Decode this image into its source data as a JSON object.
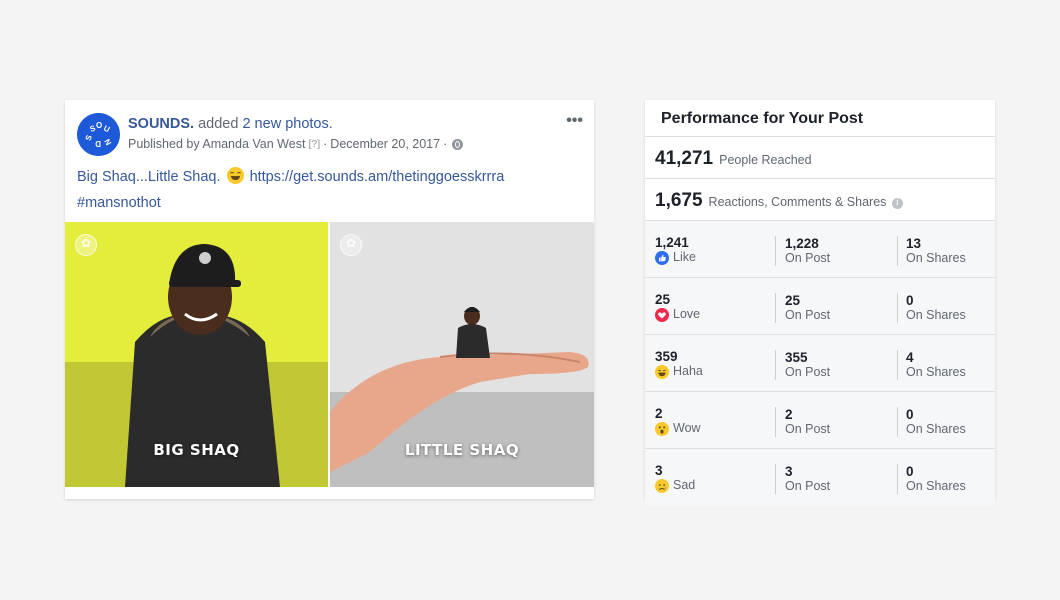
{
  "post": {
    "page_name": "SOUNDS.",
    "action_text": " added ",
    "photos_link": "2 new photos.",
    "published_by": "Published by Amanda Van West",
    "help_marker": "[?]",
    "separator": "·",
    "date": "December 20, 2017",
    "text_prefix": "Big Shaq...Little Shaq.",
    "text_link": "https://get.sounds.am/thetinggoesskrrra",
    "hashtag": "#mansnothot",
    "more_label": "•••",
    "avatar_text": "SOUNDS",
    "photos": [
      {
        "caption": "BIG SHAQ"
      },
      {
        "caption": "LITTLE SHAQ"
      }
    ]
  },
  "performance": {
    "title": "Performance for Your Post",
    "reach": {
      "value": "41,271",
      "label": "People Reached"
    },
    "engagement": {
      "value": "1,675",
      "label": "Reactions, Comments & Shares",
      "info": "i"
    },
    "rows": [
      {
        "total": "1,241",
        "reaction": "Like",
        "icon": "like-icon",
        "on_post": "1,228",
        "on_post_label": "On Post",
        "on_shares": "13",
        "on_shares_label": "On Shares"
      },
      {
        "total": "25",
        "reaction": "Love",
        "icon": "love-icon",
        "on_post": "25",
        "on_post_label": "On Post",
        "on_shares": "0",
        "on_shares_label": "On Shares"
      },
      {
        "total": "359",
        "reaction": "Haha",
        "icon": "haha-icon",
        "on_post": "355",
        "on_post_label": "On Post",
        "on_shares": "4",
        "on_shares_label": "On Shares"
      },
      {
        "total": "2",
        "reaction": "Wow",
        "icon": "wow-icon",
        "on_post": "2",
        "on_post_label": "On Post",
        "on_shares": "0",
        "on_shares_label": "On Shares"
      },
      {
        "total": "3",
        "reaction": "Sad",
        "icon": "sad-icon",
        "on_post": "3",
        "on_post_label": "On Post",
        "on_shares": "0",
        "on_shares_label": "On Shares"
      }
    ]
  },
  "colors": {
    "link": "#365899",
    "avatar_bg": "#1e5ad8",
    "like": "#2d6cef",
    "love": "#f0284a",
    "emoji_yellow": "#f7c92b",
    "photo1_bg": "#e6ef3a",
    "photo2_bg": "#e3e3e3"
  }
}
